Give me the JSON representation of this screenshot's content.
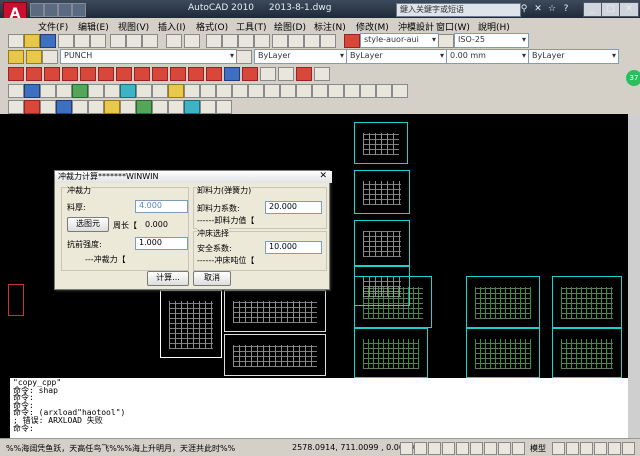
{
  "app": {
    "title_app": "AutoCAD 2010",
    "title_file": "2013-8-1.dwg",
    "search_placeholder": "鍵入关鍵字或短语",
    "logo_letter": "A"
  },
  "menu": [
    "文件(F)",
    "编辑(E)",
    "视图(V)",
    "插入(I)",
    "格式(O)",
    "工具(T)",
    "绘图(D)",
    "标注(N)",
    "修改(M)",
    "沖模設計",
    "窗口(W)",
    "說明(H)"
  ],
  "toolbar": {
    "textstyle": "style-auor-aui",
    "dimstyle": "ISO-25",
    "layer": "PUNCH",
    "color": "ByLayer",
    "linetype": "ByLayer",
    "lineweight": "0.00 mm",
    "plotstyle": "ByLayer"
  },
  "badge": "37",
  "dialog": {
    "title": "冲裁力计算*******WINWIN",
    "group_punch": "冲裁力",
    "thickness_label": "料厚:",
    "thickness_value": "4.000",
    "select_button": "选图元",
    "perimeter_label": "周长【",
    "perimeter_value": "0.000",
    "strength_label": "抗前强度:",
    "strength_value": "1.000",
    "punch_force_label": "---冲裁力【",
    "group_strip": "卸料力(弹簧力)",
    "strip_coef_label": "卸料力系数:",
    "strip_coef_value": "20.000",
    "strip_force_label": "------卸料力值【",
    "group_press": "冲床选择",
    "safety_label": "安全系数:",
    "safety_value": "10.000",
    "press_ton_label": "------冲床吨位【",
    "calc_button": "计算...",
    "cancel_button": "取消"
  },
  "command_lines": [
    "\"copy_cpp\"",
    "命令: shap",
    "命令:",
    "命令:",
    "命令: (arxload\"haotool\")",
    "; 错误: ARXLOAD 失败",
    "命令:"
  ],
  "status": {
    "text": "%%海阔凭鱼跃，天高任鸟飞%%%海上升明月，天涯共此时%%",
    "coords": "2578.0914, 711.0099 , 0.0000",
    "model": "模型"
  }
}
